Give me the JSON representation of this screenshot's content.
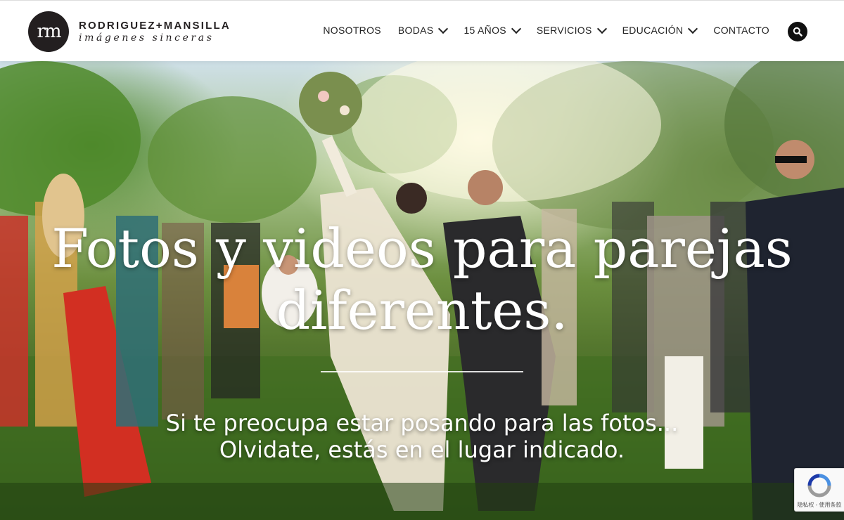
{
  "brand": {
    "monogram": "rm",
    "name": "RODRIGUEZ+MANSILLA",
    "tagline": "imágenes sinceras"
  },
  "nav": {
    "items": [
      {
        "label": "NOSOTROS",
        "dropdown": false
      },
      {
        "label": "BODAS",
        "dropdown": true
      },
      {
        "label": "15 AÑOS",
        "dropdown": true
      },
      {
        "label": "SERVICIOS",
        "dropdown": true
      },
      {
        "label": "EDUCACIÓN",
        "dropdown": true
      },
      {
        "label": "CONTACTO",
        "dropdown": false
      }
    ],
    "search_icon": "search-icon"
  },
  "hero": {
    "title_line1": "Fotos y videos para parejas",
    "title_line2": "diferentes.",
    "subtitle_line1": "Si te preocupa estar posando para las fotos...",
    "subtitle_line2": "Olvidate, estás en el lugar indicado."
  },
  "recaptcha": {
    "links": "隐私权 - 使用条款"
  },
  "colors": {
    "brand_dark": "#231f20",
    "hero_text": "#ffffff"
  }
}
